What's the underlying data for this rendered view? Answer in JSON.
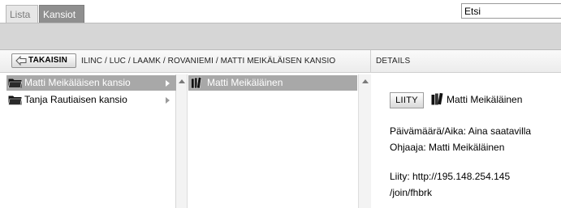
{
  "tabs": {
    "list": "Lista",
    "folders": "Kansiot"
  },
  "search": {
    "value": "Etsi"
  },
  "toolbar": {
    "back_label": "TAKAISIN"
  },
  "breadcrumb": "ILINC / LUC / LAAMK / ROVANIEMI / MATTI MEIKÄLÄISEN KANSIO",
  "details_header": "DETAILS",
  "folders": [
    {
      "label": "Matti Meikäläisen kansio",
      "selected": true
    },
    {
      "label": "Tanja Rautiaisen kansio",
      "selected": false
    }
  ],
  "rooms": [
    {
      "label": "Matti Meikäläinen",
      "selected": true
    }
  ],
  "details": {
    "join_button": "LIITY",
    "room_name": "Matti Meikäläinen",
    "datetime_line": "Päivämäärä/Aika: Aina saatavilla",
    "host_line": "Ohjaaja: Matti Meikäläinen",
    "link_line1": "Liity: http://195.148.254.145",
    "link_line2": "/join/fhbrk"
  },
  "colors": {
    "selected_row": "#a8a8a8",
    "active_tab": "#8f8f8f",
    "strip": "#d6d6d6"
  },
  "icons": [
    "back-arrow-icon",
    "folder-icon",
    "chevron-right-icon",
    "scroll-up-icon",
    "book-icon"
  ]
}
